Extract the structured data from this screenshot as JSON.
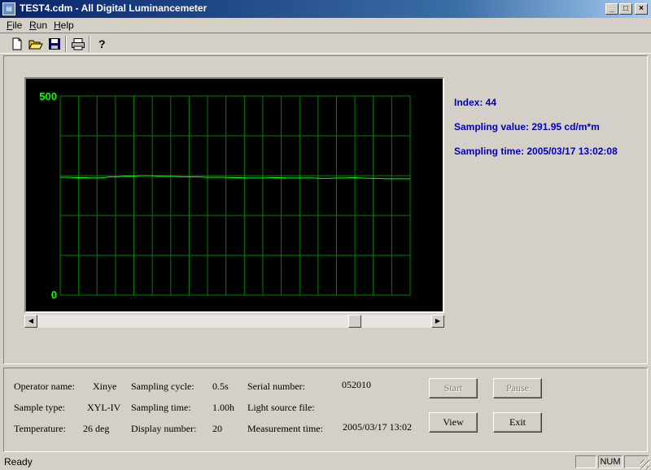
{
  "window": {
    "title": "TEST4.cdm - All Digital Luminancemeter"
  },
  "menu": [
    {
      "label": "File",
      "accel": "F",
      "rest": "ile"
    },
    {
      "label": "Run",
      "accel": "R",
      "rest": "un"
    },
    {
      "label": "Help",
      "accel": "H",
      "rest": "elp"
    }
  ],
  "toolbar": [
    "new-file-icon",
    "open-folder-icon",
    "save-icon",
    "print-icon",
    "help-icon"
  ],
  "chart_data": {
    "type": "line",
    "ylim": [
      0,
      500
    ],
    "ytick_labels": [
      "500",
      "0"
    ],
    "grid": true,
    "background": "#000000",
    "grid_color": "#008000",
    "line_color": "#00ff00",
    "series": [
      {
        "values": [
          296,
          296,
          295,
          295,
          294,
          294,
          297,
          297,
          299,
          299,
          300,
          300,
          299,
          298,
          298,
          297,
          297,
          297,
          296,
          296,
          296,
          295,
          295,
          294,
          294,
          294,
          295,
          295,
          294,
          294,
          294,
          294,
          293,
          293,
          294,
          294,
          295,
          294,
          293,
          293,
          292,
          292,
          292,
          291.95
        ]
      }
    ]
  },
  "readout": {
    "index": "Index: 44",
    "sampling_value": "Sampling value: 291.95  cd/m*m",
    "sampling_time": "Sampling time: 2005/03/17 13:02:08"
  },
  "info": {
    "operator_label": "Operator name:",
    "operator_value": "Xinye",
    "sample_type_label": "Sample type:",
    "sample_type_value": "XYL-IV",
    "temperature_label": "Temperature:",
    "temperature_value": "26 deg",
    "sampling_cycle_label": "Sampling cycle:",
    "sampling_cycle_value": "0.5s",
    "sampling_time_label": "Sampling time:",
    "sampling_time_value": "1.00h",
    "display_number_label": "Display number:",
    "display_number_value": "20",
    "serial_label": "Serial number:",
    "serial_value": "052010",
    "light_source_label": "Light source file:",
    "measurement_time_label": "Measurement time:",
    "measurement_time_value": "2005/03/17 13:02"
  },
  "buttons": {
    "start": "Start",
    "pause": "Pause",
    "view": "View",
    "exit": "Exit"
  },
  "status": {
    "text": "Ready",
    "num": "NUM"
  },
  "colors": {
    "readout": "#0000c0",
    "title_start": "#0a246a",
    "face": "#d4d0c8"
  }
}
